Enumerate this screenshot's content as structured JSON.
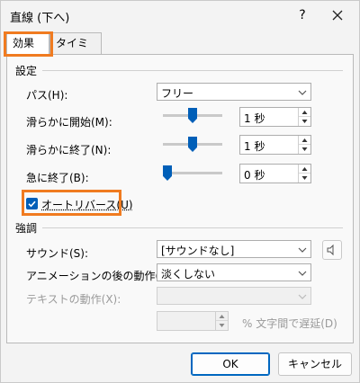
{
  "window": {
    "title": "直線 (下へ)",
    "help": "?"
  },
  "tabs": [
    {
      "label": "効果"
    },
    {
      "label": "タイミング"
    }
  ],
  "settings": {
    "group_label": "設定",
    "path": {
      "label": "パス(H):",
      "value": "フリー"
    },
    "smooth_start": {
      "label": "滑らかに開始(M):",
      "value": "1 秒",
      "slider_level": 0.5
    },
    "smooth_end": {
      "label": "滑らかに終了(N):",
      "value": "1 秒",
      "slider_level": 0.5
    },
    "bounce_end": {
      "label": "急に終了(B):",
      "value": "0 秒",
      "slider_level": 0.0
    },
    "auto_reverse": {
      "label": "オートリバース(U)",
      "checked": true
    }
  },
  "enhancements": {
    "group_label": "強調",
    "sound": {
      "label": "サウンド(S):",
      "value": "[サウンドなし]"
    },
    "after_animation": {
      "label": "アニメーションの後の動作(A):",
      "value": "淡くしない"
    },
    "animate_text": {
      "label": "テキストの動作(X):",
      "value": ""
    },
    "delay": {
      "value": "",
      "suffix": "% 文字間で遅延(D)"
    }
  },
  "buttons": {
    "ok": "OK",
    "cancel": "キャンセル"
  },
  "colors": {
    "accent": "#005fb8",
    "highlight": "#f07b20"
  }
}
